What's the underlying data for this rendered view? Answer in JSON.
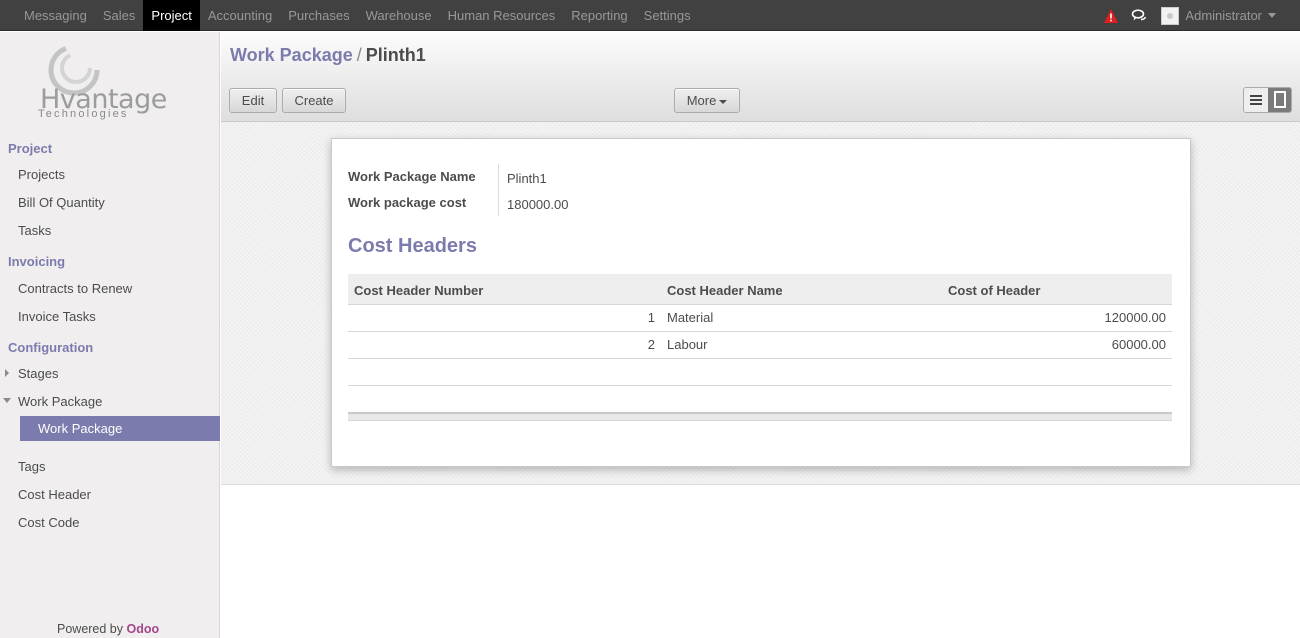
{
  "topbar": {
    "menu": [
      "Messaging",
      "Sales",
      "Project",
      "Accounting",
      "Purchases",
      "Warehouse",
      "Human Resources",
      "Reporting",
      "Settings"
    ],
    "active": "Project",
    "user": "Administrator",
    "alert_color": "#e02020"
  },
  "logo": {
    "name": "Hvantage",
    "sub": "Technologies"
  },
  "sidebar": {
    "sections": [
      {
        "title": "Project",
        "items": [
          "Projects",
          "Bill Of Quantity",
          "Tasks"
        ]
      },
      {
        "title": "Invoicing",
        "items": [
          "Contracts to Renew",
          "Invoice Tasks"
        ]
      },
      {
        "title": "Configuration",
        "items": [
          "Stages",
          "Work Package",
          "Work Package",
          "Tags",
          "Cost Header",
          "Cost Code"
        ]
      }
    ],
    "powered_by": "Powered by",
    "powered_brand": "Odoo"
  },
  "header": {
    "breadcrumb_parent": "Work Package",
    "breadcrumb_sep": "/",
    "breadcrumb_current": "Plinth1",
    "edit_label": "Edit",
    "create_label": "Create",
    "more_label": "More"
  },
  "form": {
    "fields": [
      {
        "label": "Work Package Name",
        "value": "Plinth1"
      },
      {
        "label": "Work package cost",
        "value": "180000.00"
      }
    ],
    "section_title": "Cost Headers",
    "columns": [
      "Cost Header Number",
      "Cost Header Name",
      "Cost of Header"
    ],
    "rows": [
      {
        "number": "1",
        "name": "Material",
        "cost": "120000.00"
      },
      {
        "number": "2",
        "name": "Labour",
        "cost": "60000.00"
      }
    ]
  },
  "colors": {
    "accent": "#7c7bad",
    "topbar": "#414141",
    "odoo": "#a24689"
  }
}
